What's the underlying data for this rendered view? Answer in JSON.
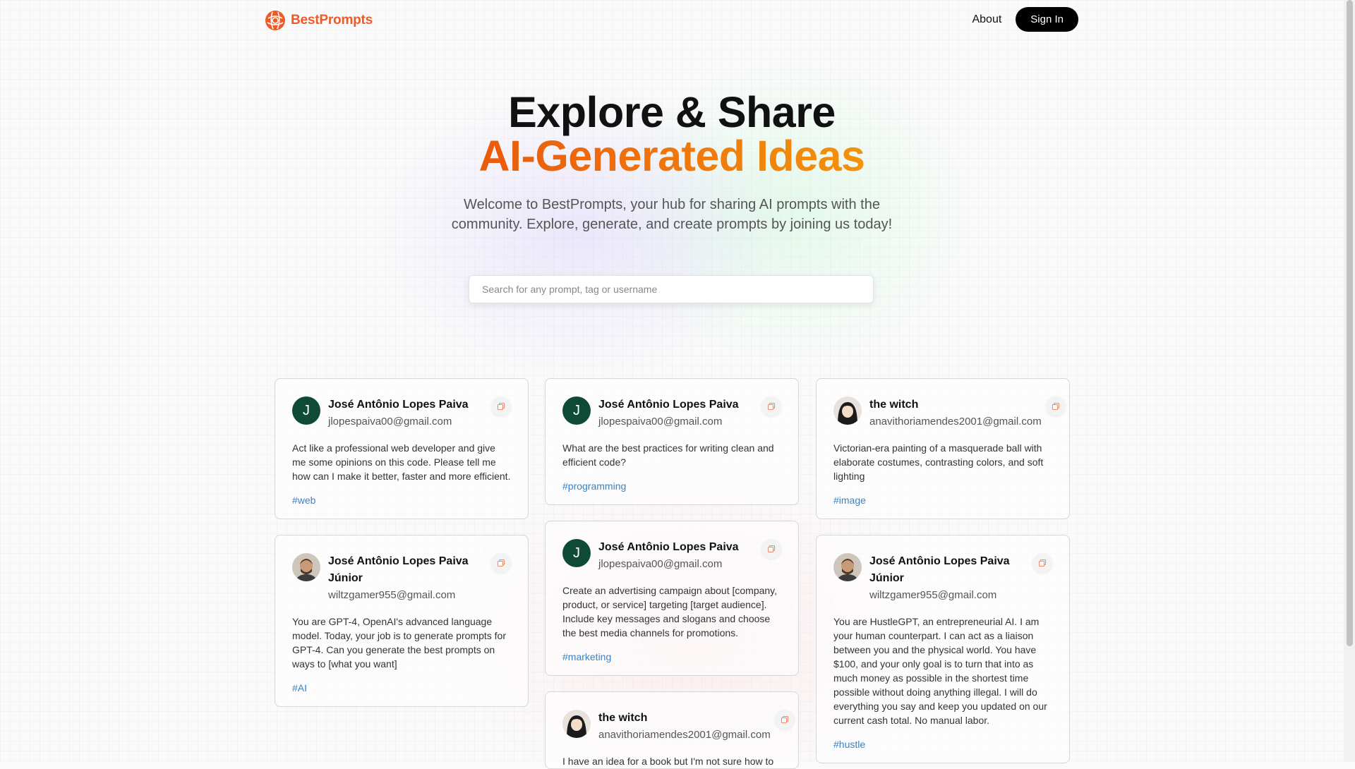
{
  "nav": {
    "brand": "BestPrompts",
    "about": "About",
    "signin": "Sign In"
  },
  "hero": {
    "title_line1": "Explore & Share",
    "title_line2": "AI-Generated Ideas",
    "subtitle": "Welcome to BestPrompts, your hub for sharing AI prompts with the community. Explore, generate, and create prompts by joining us today!"
  },
  "search": {
    "placeholder": "Search for any prompt, tag or username",
    "value": ""
  },
  "cards": [
    {
      "name": "José Antônio Lopes Paiva",
      "email": "jlopespaiva00@gmail.com",
      "avatar": "J",
      "prompt": "Act like a professional web developer and give me some opinions on this code. Please tell me how can I make it better, faster and more efficient.",
      "tag": "#web"
    },
    {
      "name": "José Antônio Lopes Paiva",
      "email": "jlopespaiva00@gmail.com",
      "avatar": "J",
      "prompt": "What are the best practices for writing clean and efficient code?",
      "tag": "#programming"
    },
    {
      "name": "the witch",
      "email": "anavithoriamendes2001@gmail.com",
      "avatar": "",
      "prompt": "Victorian-era painting of a masquerade ball with elaborate costumes, contrasting colors, and soft lighting",
      "tag": "#image"
    },
    {
      "name": "José Antônio Lopes Paiva Júnior",
      "email": "wiltzgamer955@gmail.com",
      "avatar": "",
      "prompt": "You are GPT-4, OpenAI's advanced language model. Today, your job is to generate prompts for GPT-4. Can you generate the best prompts on ways to [what you want]",
      "tag": "#AI"
    },
    {
      "name": "José Antônio Lopes Paiva",
      "email": "jlopespaiva00@gmail.com",
      "avatar": "J",
      "prompt": "Create an advertising campaign about [company, product, or service] targeting [target audience]. Include key messages and slogans and choose the best media channels for promotions.",
      "tag": "#marketing"
    },
    {
      "name": "José Antônio Lopes Paiva Júnior",
      "email": "wiltzgamer955@gmail.com",
      "avatar": "",
      "prompt": "You are HustleGPT, an entrepreneurial AI. I am your human counterpart. I can act as a liaison between you and the physical world. You have $100, and your only goal is to turn that into as much money as possible in the shortest time possible without doing anything illegal. I will do everything you say and keep you updated on our current cash total. No manual labor.",
      "tag": "#hustle"
    },
    {
      "name": "the witch",
      "email": "anavithoriamendes2001@gmail.com",
      "avatar": "",
      "prompt": "I have an idea for a book but I'm not sure how to",
      "tag": ""
    }
  ],
  "colors": {
    "brand": "#f05a28",
    "accent_gradient": [
      "#f59e0b",
      "#ea580c",
      "#eab308"
    ],
    "tag": "#3b82c4",
    "avatar_letter_bg": "#0f4a36"
  },
  "icons": [
    "brand-logo-icon",
    "copy-icon",
    "user-photo-avatar"
  ]
}
